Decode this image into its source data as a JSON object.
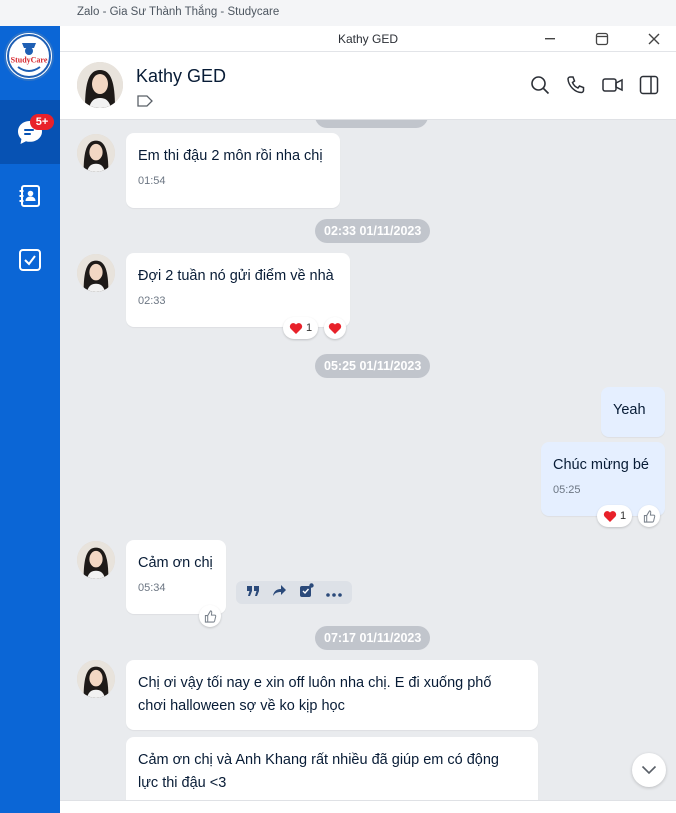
{
  "app_title": "Zalo - Gia Sư Thành Thắng - Studycare",
  "window_title": "Kathy GED",
  "nav": {
    "logo_text": "StudyCare",
    "chat_badge": "5+"
  },
  "header": {
    "contact_name": "Kathy GED"
  },
  "messages": {
    "m1": {
      "text": "Em thi đậu 2 môn rồi nha chị",
      "time": "01:54"
    },
    "divider1": "02:33 01/11/2023",
    "m2": {
      "text": "Đợi 2 tuần nó gửi điểm về nhà",
      "time": "02:33",
      "reaction_count": "1"
    },
    "divider2": "05:25 01/11/2023",
    "m3": {
      "text": "Yeah"
    },
    "m4": {
      "text": "Chúc mừng bé",
      "time": "05:25",
      "reaction_count": "1"
    },
    "m5": {
      "text": "Cảm ơn chị",
      "time": "05:34"
    },
    "divider3": "07:17 01/11/2023",
    "m6": {
      "line1": "Chị ơi vậy tối nay e xin off luôn nha chị. E đi xuống phố",
      "line2": "chơi halloween sợ về ko kịp học"
    },
    "m7": {
      "line1": "Cảm ơn chị và Anh Khang rất nhiều đã giúp em có động",
      "line2": "lực thi đậu <3"
    }
  },
  "colors": {
    "nav_bg": "#0b66d6",
    "nav_active": "#0752b3",
    "my_bubble": "#e5efff",
    "heart": "#e8212a"
  }
}
